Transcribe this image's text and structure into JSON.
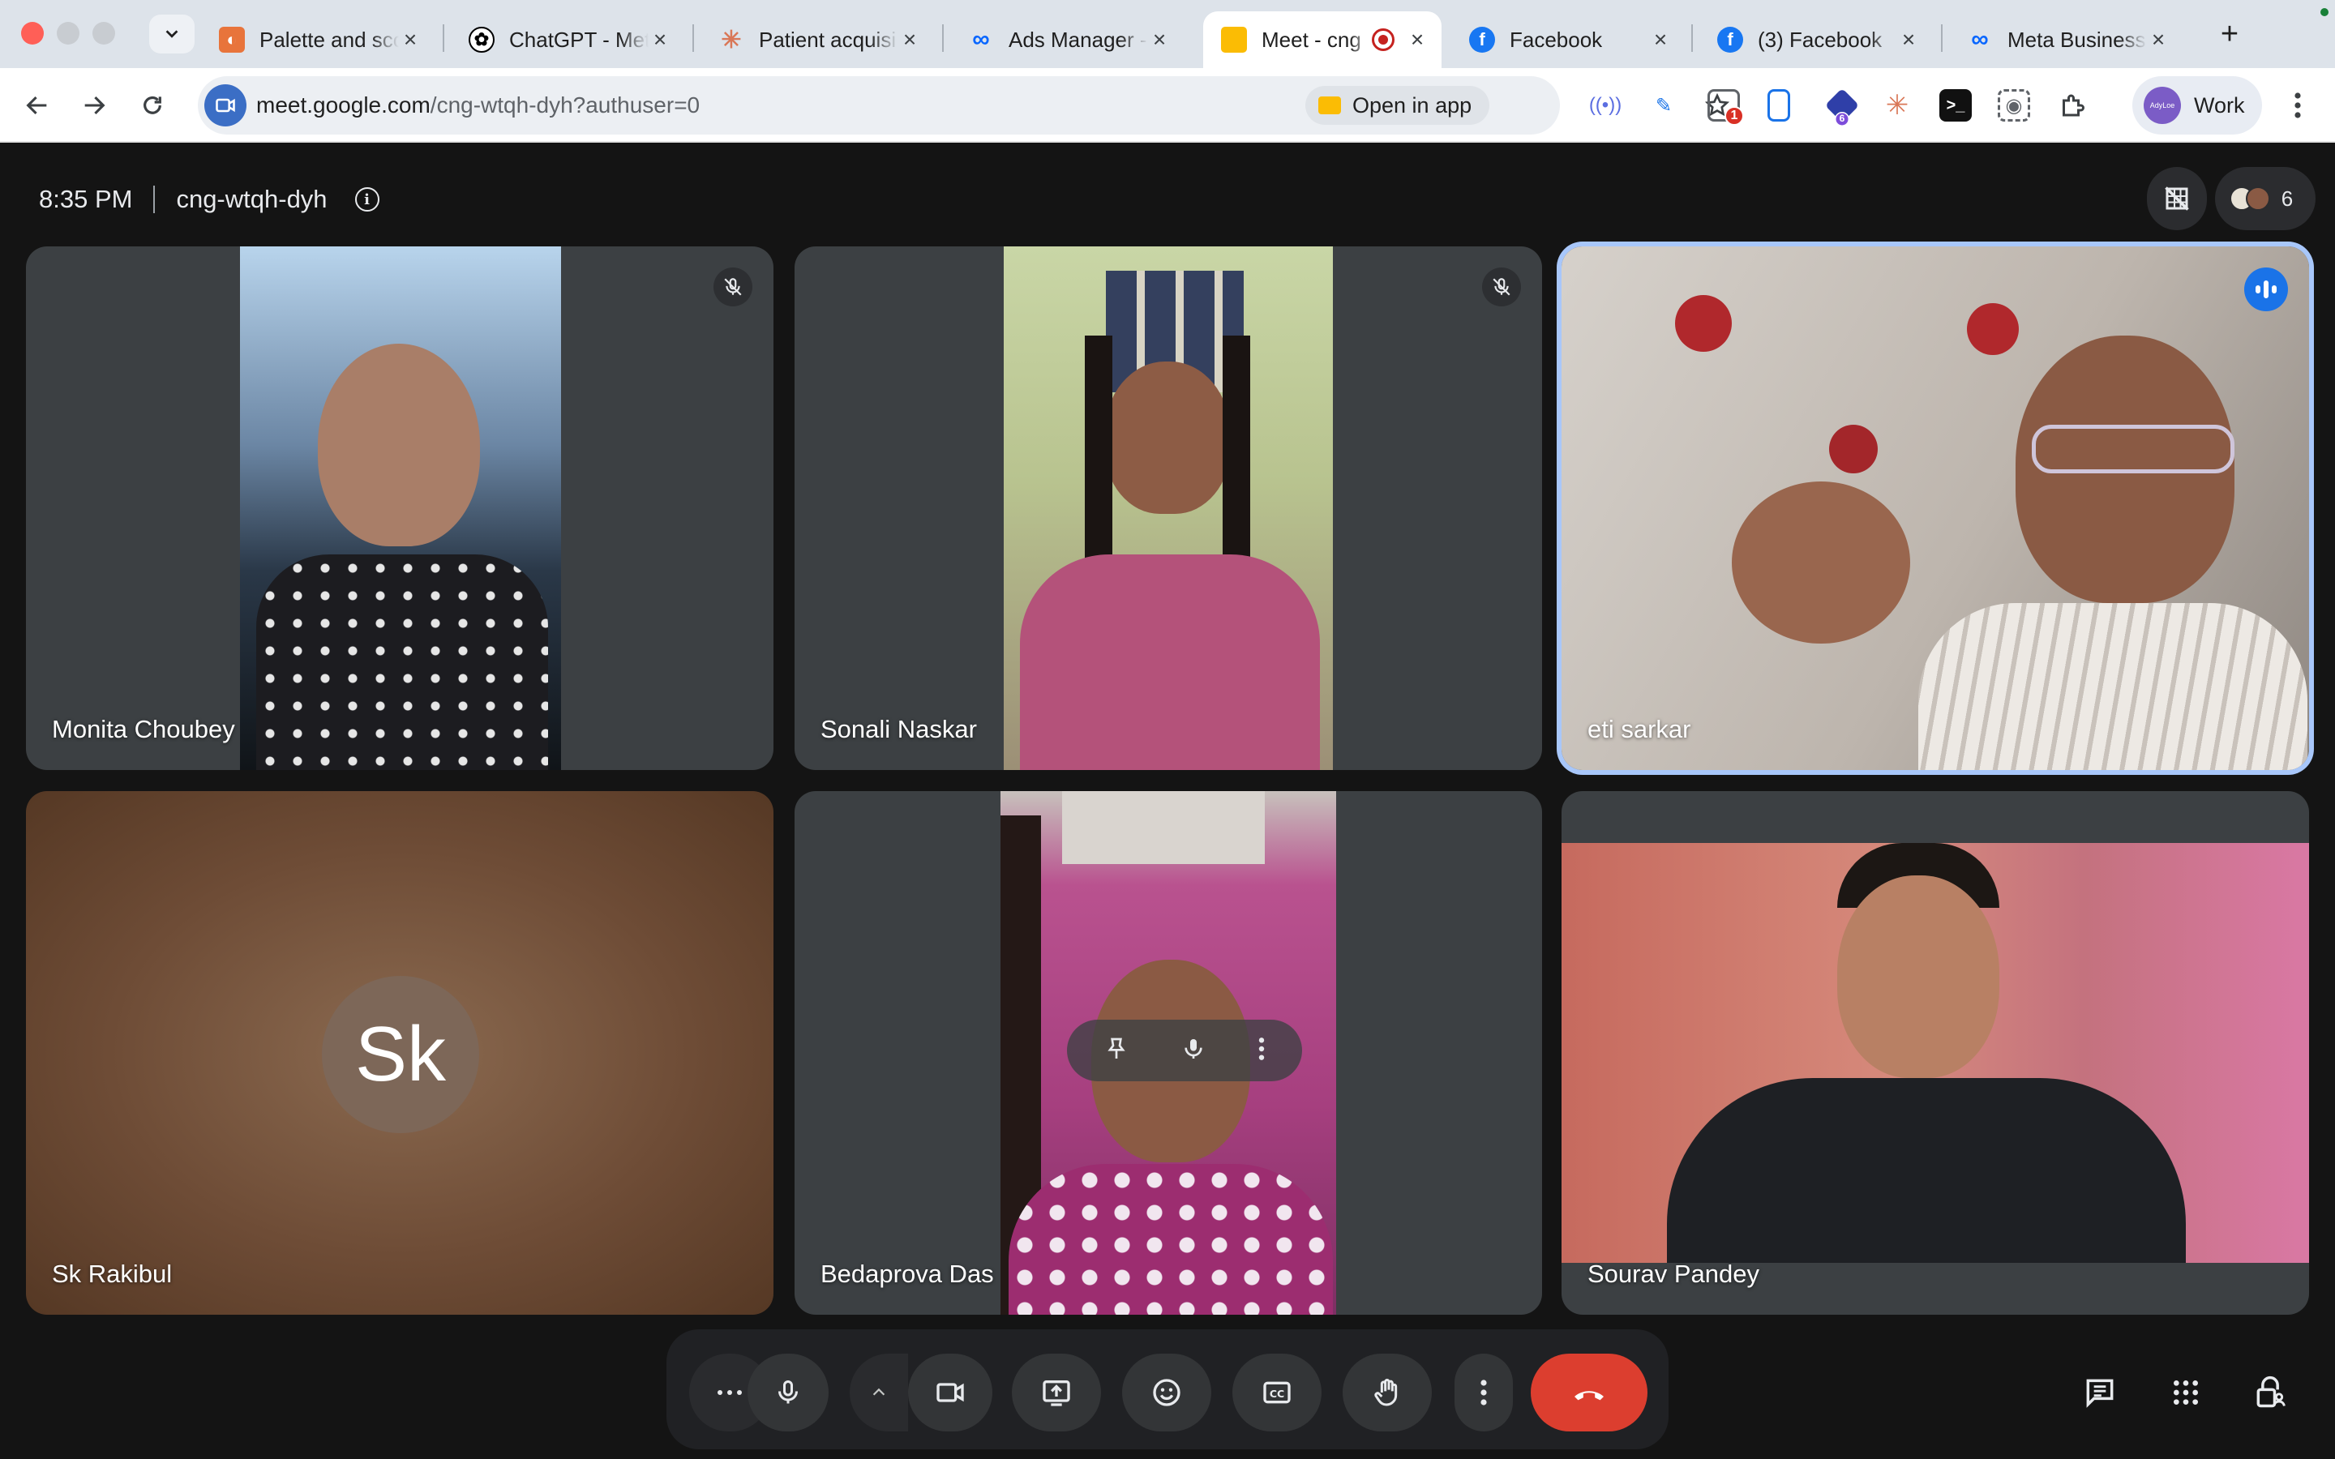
{
  "browser": {
    "tabs": [
      {
        "label": "Palette and sco",
        "favicon": "palette-icon",
        "color": "#e8743b"
      },
      {
        "label": "ChatGPT - Met",
        "favicon": "chatgpt-icon",
        "color": "#000000"
      },
      {
        "label": "Patient acquisi",
        "favicon": "claude-icon",
        "color": "#d97757"
      },
      {
        "label": "Ads Manager -",
        "favicon": "meta-icon",
        "color": "#0866ff"
      },
      {
        "label": "Meet - cng",
        "favicon": "meet-icon",
        "color": "#fbbc04",
        "active": true,
        "recording": true
      },
      {
        "label": "Facebook",
        "favicon": "facebook-icon",
        "color": "#1877f2"
      },
      {
        "label": "(3) Facebook",
        "favicon": "facebook-icon",
        "color": "#1877f2"
      },
      {
        "label": "Meta Business",
        "favicon": "meta-icon",
        "color": "#0866ff"
      }
    ],
    "url_host": "meet.google.com",
    "url_path": "/cng-wtqh-dyh?authuser=0",
    "open_in_app": "Open in app",
    "extensions": [
      {
        "name": "signal-extension-icon"
      },
      {
        "name": "pen-extension-icon"
      },
      {
        "name": "screen-capture-extension-icon",
        "badge": "1"
      },
      {
        "name": "clipboard-extension-icon"
      },
      {
        "name": "bookmark-extension-icon",
        "badge": "6"
      },
      {
        "name": "claude-extension-icon"
      },
      {
        "name": "terminal-extension-icon"
      },
      {
        "name": "screenshot-extension-icon"
      },
      {
        "name": "puzzle-icon"
      }
    ],
    "profile_label": "Work",
    "profile_avatar_text": "AdyLoe"
  },
  "meeting": {
    "time": "8:35 PM",
    "code": "cng-wtqh-dyh",
    "participant_count": "6"
  },
  "participants": [
    {
      "name": "Monita Choubey",
      "muted": true,
      "video": true,
      "bg": "#6b86a4"
    },
    {
      "name": "Sonali Naskar",
      "muted": true,
      "video": true,
      "bg": "#a99b7b"
    },
    {
      "name": "eti sarkar",
      "muted": false,
      "speaking": true,
      "video": true,
      "bg": "#c9c3bc"
    },
    {
      "name": "Sk Rakibul",
      "initials": "Sk",
      "video": false
    },
    {
      "name": "Bedaprova Das",
      "video": true,
      "bg": "#b9528f"
    },
    {
      "name": "Sourav Pandey",
      "video": true,
      "bg": "#c3746b"
    }
  ],
  "controls": {
    "more_options": "more-options-icon",
    "mic": "mic-icon",
    "camera": "videocam-icon",
    "present": "present-screen-icon",
    "reactions": "emoji-icon",
    "captions": "captions-icon",
    "hand": "raise-hand-icon",
    "more": "more-vert-icon",
    "leave": "call-end-icon",
    "end_color": "#dc3e2f"
  }
}
